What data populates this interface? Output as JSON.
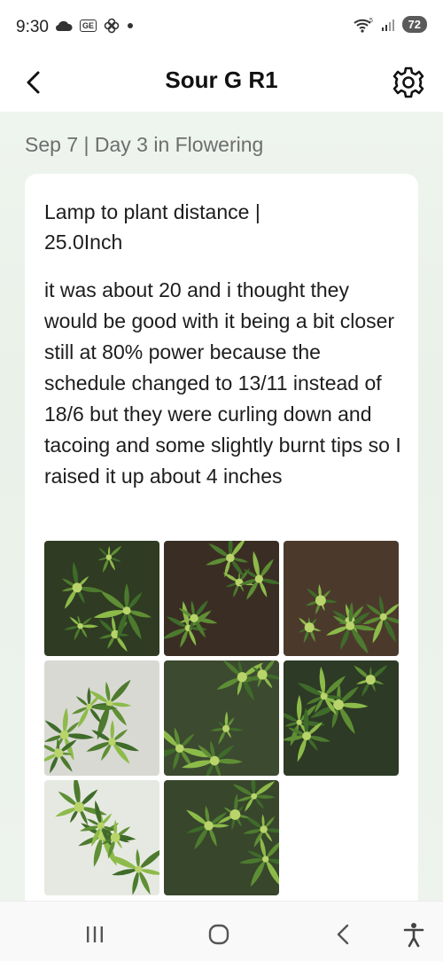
{
  "status_bar": {
    "time": "9:30",
    "left_icons": [
      "cloud-icon",
      "ge-badge-icon",
      "pinwheel-icon",
      "dot-icon"
    ],
    "ge_label": "GE",
    "battery": "72",
    "wifi_badge": "5"
  },
  "header": {
    "title": "Sour G R1"
  },
  "entry": {
    "date_line": "Sep 7 | Day 3 in Flowering",
    "lamp_line1": "Lamp to plant distance |",
    "lamp_line2": "25.0Inch",
    "note": "it was about 20 and i thought they would be good with it being a bit closer still at 80% power because the schedule changed to 13/11 instead of 18/6 but they were curling down and tacoing and some slightly burnt tips so I raised it up about 4 inches",
    "photo_count": 8
  },
  "colors": {
    "leaf_dark": "#3f6b2a",
    "leaf_light": "#8dbb4a",
    "background_tint": "#e9f1e9"
  }
}
